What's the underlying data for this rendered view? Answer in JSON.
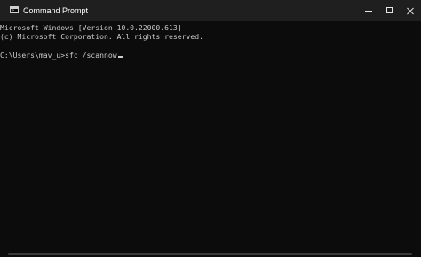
{
  "window": {
    "title": "Command Prompt",
    "icon": "cmd-icon"
  },
  "titlebar_buttons": {
    "minimize": "minimize-icon",
    "maximize": "maximize-icon",
    "close": "close-icon"
  },
  "console": {
    "lines": [
      "Microsoft Windows [Version 10.0.22000.613]",
      "(c) Microsoft Corporation. All rights reserved."
    ],
    "prompt": "C:\\Users\\mav_u>",
    "command": "sfc /scannow"
  },
  "colors": {
    "background": "#0c0c0c",
    "titlebar": "#1f1f1f",
    "text": "#cccccc"
  }
}
